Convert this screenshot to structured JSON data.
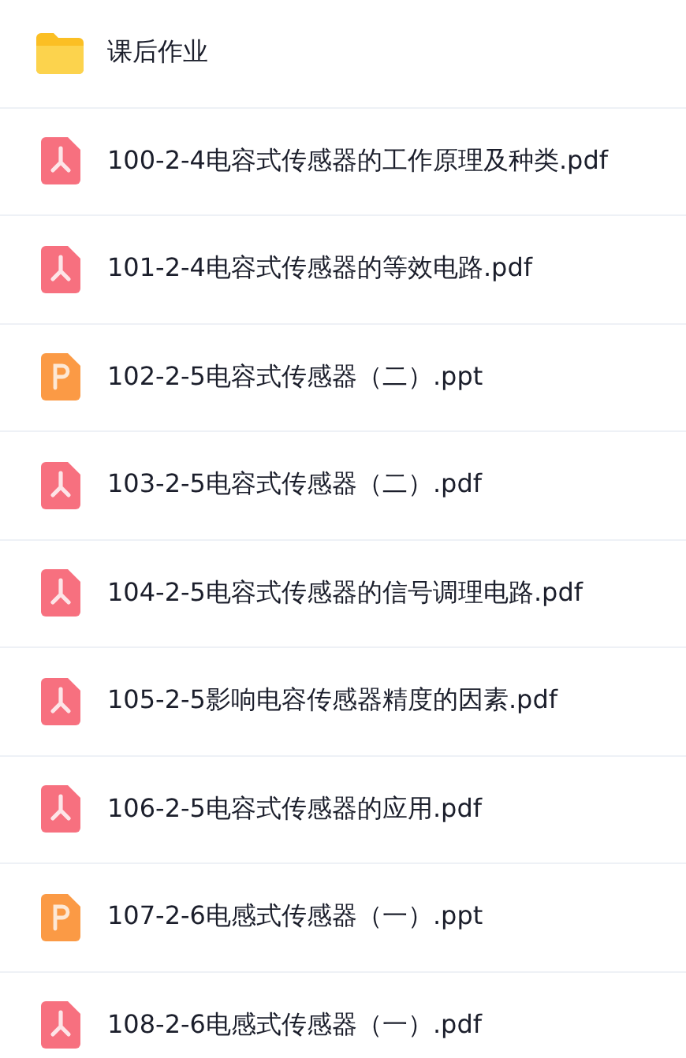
{
  "files": [
    {
      "kind": "folder",
      "name": "课后作业"
    },
    {
      "kind": "pdf",
      "name": "100-2-4电容式传感器的工作原理及种类.pdf"
    },
    {
      "kind": "pdf",
      "name": "101-2-4电容式传感器的等效电路.pdf"
    },
    {
      "kind": "ppt",
      "name": "102-2-5电容式传感器（二）.ppt"
    },
    {
      "kind": "pdf",
      "name": "103-2-5电容式传感器（二）.pdf"
    },
    {
      "kind": "pdf",
      "name": "104-2-5电容式传感器的信号调理电路.pdf"
    },
    {
      "kind": "pdf",
      "name": "105-2-5影响电容传感器精度的因素.pdf"
    },
    {
      "kind": "pdf",
      "name": "106-2-5电容式传感器的应用.pdf"
    },
    {
      "kind": "ppt",
      "name": "107-2-6电感式传感器（一）.ppt"
    },
    {
      "kind": "pdf",
      "name": "108-2-6电感式传感器（一）.pdf"
    }
  ]
}
